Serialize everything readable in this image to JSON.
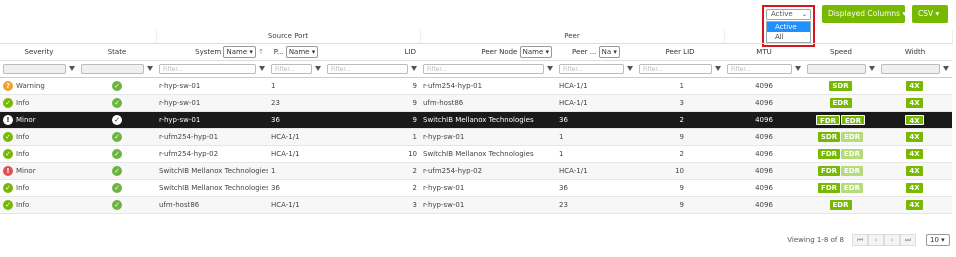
{
  "toolbar": {
    "status_selected": "Active",
    "status_options": [
      "Active",
      "All"
    ],
    "columns_button": "Displayed Columns ▾",
    "csv_button": "CSV ▾"
  },
  "groups": {
    "source_port": "Source Port",
    "peer": "Peer"
  },
  "headers": {
    "severity": "Severity",
    "state": "State",
    "system": "System",
    "system_select": "Name",
    "port": "P...",
    "port_select": "Name",
    "lid": "LID",
    "peer_node": "Peer Node",
    "peer_node_select": "Name",
    "peer_port": "Peer ...",
    "peer_port_select": "Na",
    "peer_lid": "Peer LID",
    "mtu": "MTU",
    "speed": "Speed",
    "width": "Width"
  },
  "filter_placeholder": "Filter...",
  "rows": [
    {
      "severity": "Warning",
      "sev_type": "warn",
      "system": "r-hyp-sw-01",
      "port": "1",
      "lid": "9",
      "peer_node": "r-ufm254-hyp-01",
      "peer_port": "HCA-1/1",
      "peer_lid": "1",
      "mtu": "4096",
      "speeds": [
        {
          "l": "SDR",
          "on": true
        }
      ],
      "width": "4X"
    },
    {
      "severity": "Info",
      "sev_type": "ok",
      "system": "r-hyp-sw-01",
      "port": "23",
      "lid": "9",
      "peer_node": "ufm-host86",
      "peer_port": "HCA-1/1",
      "peer_lid": "3",
      "mtu": "4096",
      "speeds": [
        {
          "l": "EDR",
          "on": true
        }
      ],
      "width": "4X"
    },
    {
      "severity": "Minor",
      "sev_type": "minor",
      "system": "r-hyp-sw-01",
      "port": "36",
      "lid": "9",
      "peer_node": "SwitchIB Mellanox Technologies",
      "peer_port": "36",
      "peer_lid": "2",
      "mtu": "4096",
      "speeds": [
        {
          "l": "FDR",
          "on": true
        },
        {
          "l": "EDR",
          "on": true
        }
      ],
      "width": "4X"
    },
    {
      "severity": "Info",
      "sev_type": "ok",
      "system": "r-ufm254-hyp-01",
      "port": "HCA-1/1",
      "lid": "1",
      "peer_node": "r-hyp-sw-01",
      "peer_port": "1",
      "peer_lid": "9",
      "mtu": "4096",
      "speeds": [
        {
          "l": "SDR",
          "on": true
        },
        {
          "l": "EDR",
          "on": false
        }
      ],
      "width": "4X"
    },
    {
      "severity": "Info",
      "sev_type": "ok",
      "system": "r-ufm254-hyp-02",
      "port": "HCA-1/1",
      "lid": "10",
      "peer_node": "SwitchIB Mellanox Technologies",
      "peer_port": "1",
      "peer_lid": "2",
      "mtu": "4096",
      "speeds": [
        {
          "l": "FDR",
          "on": true
        },
        {
          "l": "EDR",
          "on": false
        }
      ],
      "width": "4X"
    },
    {
      "severity": "Minor",
      "sev_type": "minor",
      "system": "SwitchIB Mellanox Technologies",
      "port": "1",
      "lid": "2",
      "peer_node": "r-ufm254-hyp-02",
      "peer_port": "HCA-1/1",
      "peer_lid": "10",
      "mtu": "4096",
      "speeds": [
        {
          "l": "FDR",
          "on": true
        },
        {
          "l": "EDR",
          "on": false
        }
      ],
      "width": "4X"
    },
    {
      "severity": "Info",
      "sev_type": "ok",
      "system": "SwitchIB Mellanox Technologies",
      "port": "36",
      "lid": "2",
      "peer_node": "r-hyp-sw-01",
      "peer_port": "36",
      "peer_lid": "9",
      "mtu": "4096",
      "speeds": [
        {
          "l": "FDR",
          "on": true
        },
        {
          "l": "EDR",
          "on": false
        }
      ],
      "width": "4X"
    },
    {
      "severity": "Info",
      "sev_type": "ok",
      "system": "ufm-host86",
      "port": "HCA-1/1",
      "lid": "3",
      "peer_node": "r-hyp-sw-01",
      "peer_port": "23",
      "peer_lid": "9",
      "mtu": "4096",
      "speeds": [
        {
          "l": "EDR",
          "on": true
        }
      ],
      "width": "4X"
    }
  ],
  "selected_row": 2,
  "footer": {
    "viewing": "Viewing 1-8 of 8",
    "page_size": "10"
  },
  "colors": {
    "accent": "#76b900",
    "selected_row": "#1a1a1a",
    "highlight_box": "#d8141e"
  }
}
